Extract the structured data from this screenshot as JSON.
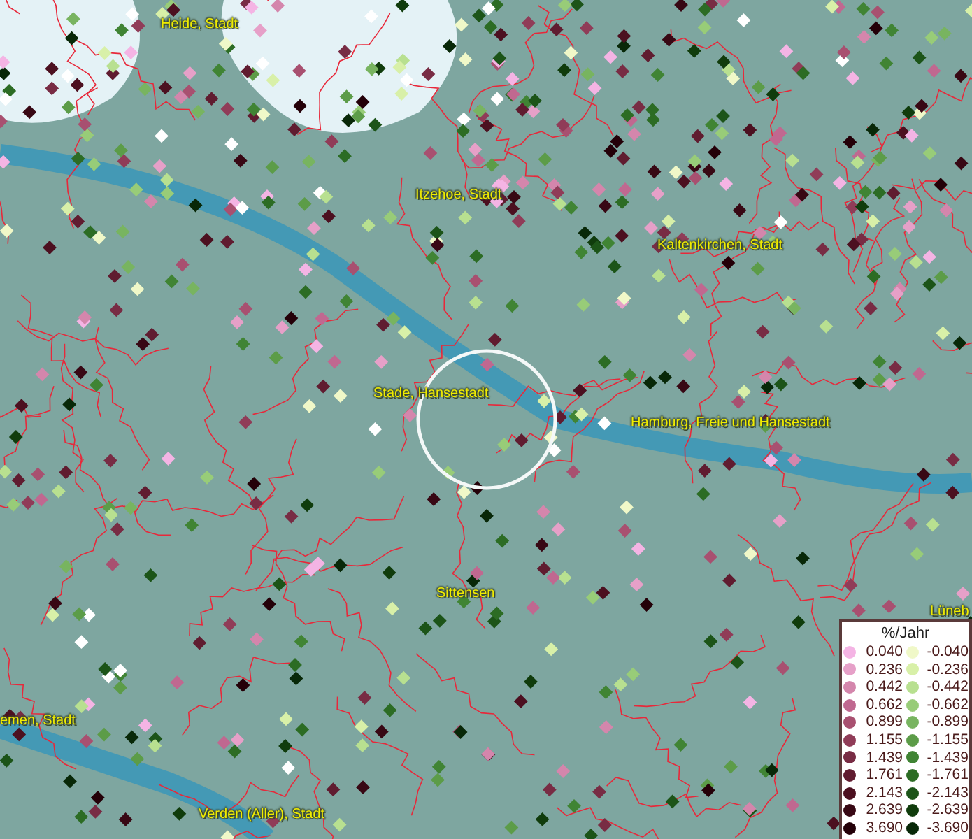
{
  "map": {
    "labels": [
      "Heide, Stadt",
      "Itzehoe, Stadt",
      "Kaltenkirchen, Stadt",
      "Stade, Hansestadt",
      "Hamburg, Freie und Hansestadt",
      "Sittensen",
      "Lüneb",
      "emen, Stadt",
      "Verden (Aller), Stadt"
    ]
  },
  "legend": {
    "title": "%/Jahr",
    "rows": [
      {
        "left": {
          "label": "0.040",
          "color": "#f4b4e4"
        },
        "right": {
          "label": "-0.040",
          "color": "#f0f8c8"
        }
      },
      {
        "left": {
          "label": "0.236",
          "color": "#e6a0c8"
        },
        "right": {
          "label": "-0.236",
          "color": "#d8f0a8"
        }
      },
      {
        "left": {
          "label": "0.442",
          "color": "#d486ac"
        },
        "right": {
          "label": "-0.442",
          "color": "#b8e090"
        }
      },
      {
        "left": {
          "label": "0.662",
          "color": "#c06890"
        },
        "right": {
          "label": "-0.662",
          "color": "#98cc78"
        }
      },
      {
        "left": {
          "label": "0.899",
          "color": "#a85070"
        },
        "right": {
          "label": "-0.899",
          "color": "#78b460"
        }
      },
      {
        "left": {
          "label": "1.155",
          "color": "#903c58"
        },
        "right": {
          "label": "-1.155",
          "color": "#5c9c48"
        }
      },
      {
        "left": {
          "label": "1.439",
          "color": "#782c44"
        },
        "right": {
          "label": "-1.439",
          "color": "#408434"
        }
      },
      {
        "left": {
          "label": "1.761",
          "color": "#601c30"
        },
        "right": {
          "label": "-1.761",
          "color": "#2c6c24"
        }
      },
      {
        "left": {
          "label": "2.143",
          "color": "#4c1020"
        },
        "right": {
          "label": "-2.143",
          "color": "#1c5418"
        }
      },
      {
        "left": {
          "label": "2.639",
          "color": "#380814"
        },
        "right": {
          "label": "-2.639",
          "color": "#103c0c"
        }
      },
      {
        "left": {
          "label": "3.690",
          "color": "#240008"
        },
        "right": {
          "label": "-3.690",
          "color": "#082808"
        }
      }
    ]
  }
}
